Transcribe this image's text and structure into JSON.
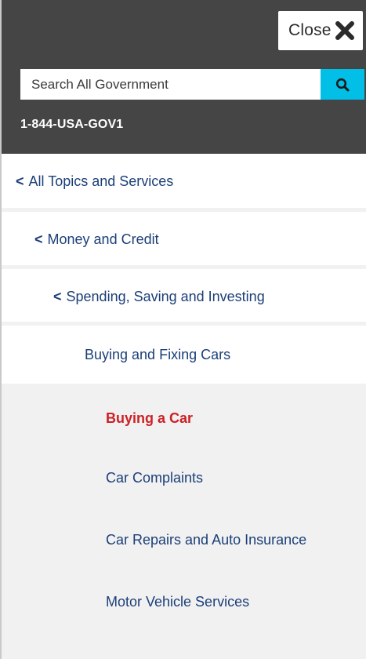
{
  "header": {
    "close_label": "Close",
    "close_icon": "close-x-icon",
    "search": {
      "placeholder": "Search All Government",
      "button_icon": "search-icon",
      "button_color": "#02bfe7"
    },
    "phone": "1-844-USA-GOV1",
    "background": "#454545"
  },
  "breadcrumbs": [
    {
      "label": "All Topics and Services",
      "prefix": "<"
    },
    {
      "label": "Money and Credit",
      "prefix": "<"
    },
    {
      "label": "Spending, Saving and Investing",
      "prefix": "<"
    }
  ],
  "current_section": "Buying and Fixing Cars",
  "sub_items": [
    {
      "label": "Buying a Car",
      "active": true
    },
    {
      "label": "Car Complaints",
      "active": false
    },
    {
      "label": "Car Repairs and Auto Insurance",
      "active": false
    },
    {
      "label": "Motor Vehicle Services",
      "active": false
    }
  ],
  "colors": {
    "link": "#1c3f78",
    "active": "#cd2026",
    "panel": "#f1f1f1"
  }
}
